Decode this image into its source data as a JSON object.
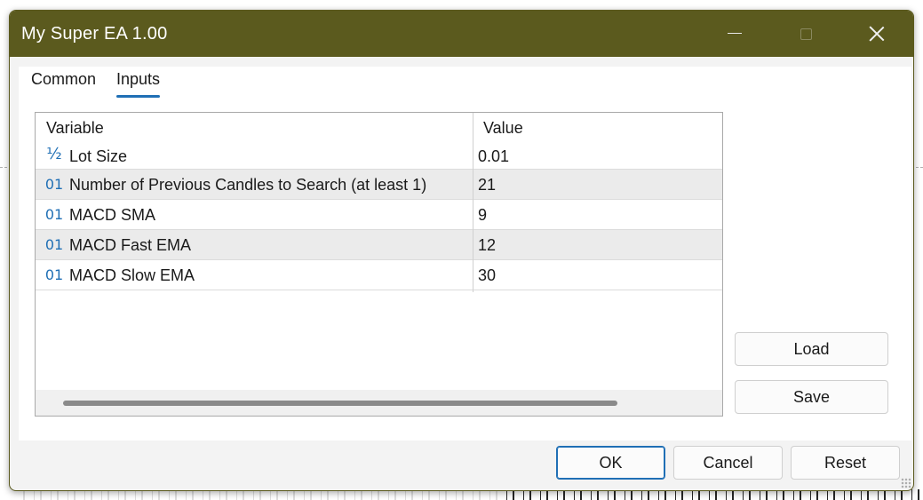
{
  "window": {
    "title": "My Super EA 1.00",
    "titlebar_color": "#5b5a1e"
  },
  "tabs": [
    {
      "label": "Common",
      "active": false
    },
    {
      "label": "Inputs",
      "active": true
    }
  ],
  "grid": {
    "columns": [
      "Variable",
      "Value"
    ],
    "rows": [
      {
        "icon": "fraction-icon",
        "glyph": "½",
        "variable": "Lot Size",
        "value": "0.01"
      },
      {
        "icon": "integer-icon",
        "glyph": "01",
        "variable": "Number of Previous Candles to Search (at least 1)",
        "value": "21"
      },
      {
        "icon": "integer-icon",
        "glyph": "01",
        "variable": "MACD SMA",
        "value": "9"
      },
      {
        "icon": "integer-icon",
        "glyph": "01",
        "variable": "MACD Fast EMA",
        "value": "12"
      },
      {
        "icon": "integer-icon",
        "glyph": "01",
        "variable": "MACD Slow EMA",
        "value": "30"
      }
    ]
  },
  "side_buttons": {
    "load": "Load",
    "save": "Save"
  },
  "footer_buttons": {
    "ok": "OK",
    "cancel": "Cancel",
    "reset": "Reset"
  },
  "accent_color": "#1f6fb5"
}
